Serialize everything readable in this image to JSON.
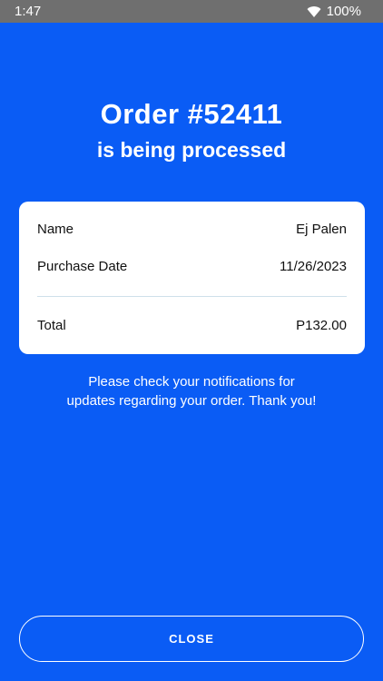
{
  "status_bar": {
    "time": "1:47",
    "battery": "100%",
    "wifi_icon": "wifi-icon"
  },
  "header": {
    "title": "Order #52411",
    "subtitle": "is being processed"
  },
  "order_summary": {
    "name_label": "Name",
    "name_value": "Ej Palen",
    "date_label": "Purchase Date",
    "date_value": "11/26/2023",
    "total_label": "Total",
    "total_value": "P132.00"
  },
  "note": {
    "line1": "Please check your notifications for",
    "line2": "updates regarding your order. Thank you!"
  },
  "actions": {
    "close_label": "CLOSE"
  },
  "colors": {
    "background": "#0a5cf5",
    "status_bar": "#6f6f6f",
    "card": "#ffffff"
  }
}
